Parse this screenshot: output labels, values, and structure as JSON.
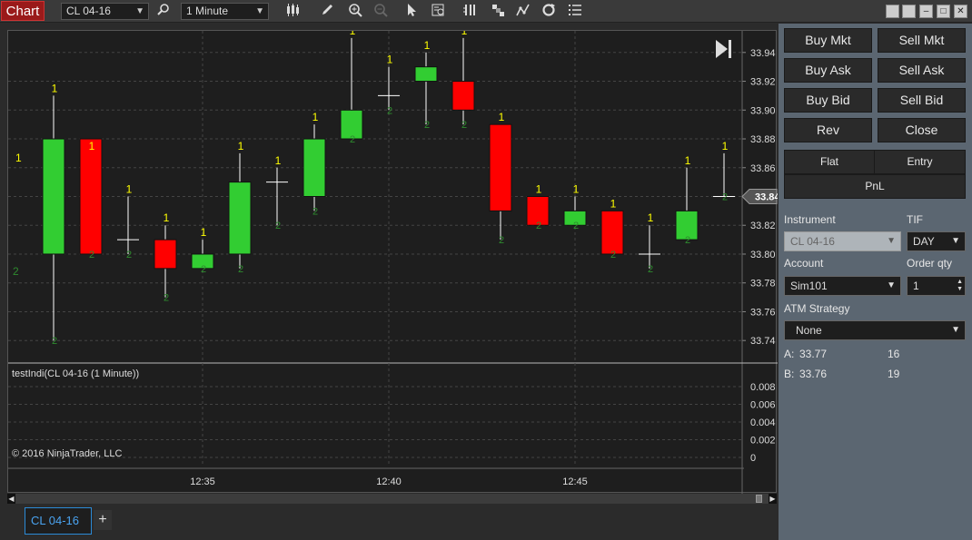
{
  "toolbar": {
    "chart_label": "Chart",
    "instrument": "CL 04-16",
    "interval": "1 Minute",
    "icons": [
      "search-icon",
      "candlestick-icon",
      "pencil-icon",
      "zoom-in-icon",
      "zoom-out-icon",
      "pointer-icon",
      "data-box-icon",
      "bar-style-icon",
      "plot-executions-icon",
      "indicators-icon",
      "refresh-icon",
      "properties-icon"
    ]
  },
  "chart": {
    "indicator_label": "testIndi(CL 04-16 (1 Minute))",
    "copyright": "© 2016 NinjaTrader, LLC",
    "current_price": "33.84",
    "colors": {
      "up": "#32cd32",
      "down": "#ff0000",
      "wick": "#ffffff",
      "label1": "#ffff00",
      "label2": "#2e8b2e",
      "grid": "#444444"
    }
  },
  "chart_data": {
    "type": "candlestick",
    "price_ticks": [
      "33.94",
      "33.92",
      "33.90",
      "33.88",
      "33.86",
      "33.84",
      "33.82",
      "33.80",
      "33.78",
      "33.76",
      "33.74"
    ],
    "indicator_ticks": [
      "0.008",
      "0.006",
      "0.004",
      "0.002",
      "0"
    ],
    "time_ticks": [
      "12:35",
      "12:40",
      "12:45"
    ],
    "ylim": [
      33.725,
      33.955
    ],
    "bars": [
      {
        "o": 33.8,
        "h": 33.91,
        "l": 33.74,
        "c": 33.88
      },
      {
        "o": 33.88,
        "h": 33.87,
        "l": 33.8,
        "c": 33.8
      },
      {
        "o": 33.81,
        "h": 33.84,
        "l": 33.8,
        "c": 33.81
      },
      {
        "o": 33.81,
        "h": 33.82,
        "l": 33.77,
        "c": 33.79
      },
      {
        "o": 33.79,
        "h": 33.81,
        "l": 33.79,
        "c": 33.8
      },
      {
        "o": 33.8,
        "h": 33.87,
        "l": 33.79,
        "c": 33.85
      },
      {
        "o": 33.85,
        "h": 33.86,
        "l": 33.82,
        "c": 33.85
      },
      {
        "o": 33.84,
        "h": 33.89,
        "l": 33.83,
        "c": 33.88
      },
      {
        "o": 33.88,
        "h": 33.95,
        "l": 33.88,
        "c": 33.9
      },
      {
        "o": 33.91,
        "h": 33.93,
        "l": 33.9,
        "c": 33.91
      },
      {
        "o": 33.92,
        "h": 33.94,
        "l": 33.89,
        "c": 33.93
      },
      {
        "o": 33.92,
        "h": 33.95,
        "l": 33.89,
        "c": 33.9
      },
      {
        "o": 33.89,
        "h": 33.89,
        "l": 33.81,
        "c": 33.83
      },
      {
        "o": 33.84,
        "h": 33.84,
        "l": 33.82,
        "c": 33.82
      },
      {
        "o": 33.82,
        "h": 33.84,
        "l": 33.82,
        "c": 33.83
      },
      {
        "o": 33.83,
        "h": 33.83,
        "l": 33.8,
        "c": 33.8
      },
      {
        "o": 33.8,
        "h": 33.82,
        "l": 33.79,
        "c": 33.8
      },
      {
        "o": 33.81,
        "h": 33.86,
        "l": 33.81,
        "c": 33.83
      },
      {
        "o": 33.84,
        "h": 33.87,
        "l": 33.84,
        "c": 33.84
      }
    ],
    "extra_labels": {
      "left_top": "1",
      "left_bottom": "2"
    }
  },
  "panel": {
    "buttons": [
      "Buy Mkt",
      "Sell Mkt",
      "Buy Ask",
      "Sell Ask",
      "Buy Bid",
      "Sell Bid",
      "Rev",
      "Close"
    ],
    "flat": "Flat",
    "entry": "Entry",
    "pnl": "PnL",
    "instrument_label": "Instrument",
    "instrument_value": "CL 04-16",
    "tif_label": "TIF",
    "tif_value": "DAY",
    "account_label": "Account",
    "account_value": "Sim101",
    "orderqty_label": "Order qty",
    "orderqty_value": "1",
    "atm_label": "ATM Strategy",
    "atm_value": "None",
    "ask_label": "A:",
    "ask_price": "33.77",
    "ask_size": "16",
    "bid_label": "B:",
    "bid_price": "33.76",
    "bid_size": "19"
  },
  "tabs": {
    "instrument_tab": "CL 04-16",
    "add": "+"
  }
}
